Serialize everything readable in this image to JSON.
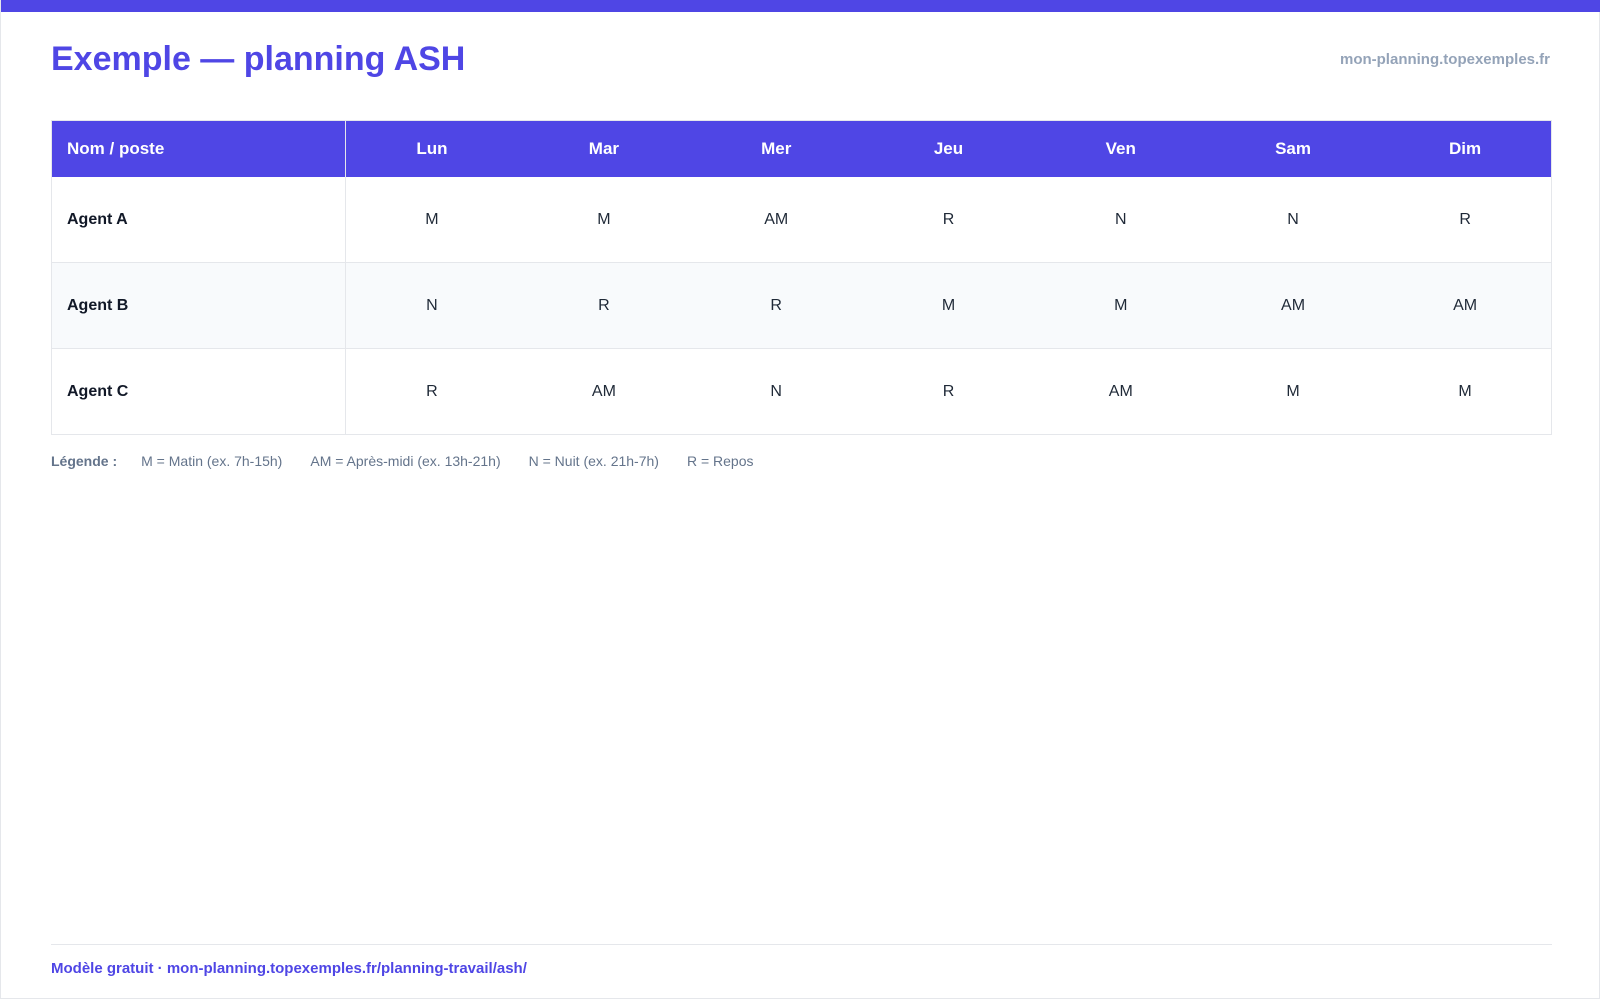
{
  "header": {
    "title": "Exemple — planning ASH",
    "site": "mon-planning.topexemples.fr"
  },
  "table": {
    "columns": [
      "Nom / poste",
      "Lun",
      "Mar",
      "Mer",
      "Jeu",
      "Ven",
      "Sam",
      "Dim"
    ],
    "rows": [
      {
        "name": "Agent A",
        "shifts": [
          "M",
          "M",
          "AM",
          "R",
          "N",
          "N",
          "R"
        ]
      },
      {
        "name": "Agent B",
        "shifts": [
          "N",
          "R",
          "R",
          "M",
          "M",
          "AM",
          "AM"
        ]
      },
      {
        "name": "Agent C",
        "shifts": [
          "R",
          "AM",
          "N",
          "R",
          "AM",
          "M",
          "M"
        ]
      }
    ]
  },
  "legend": {
    "label": "Légende :",
    "items": [
      "M = Matin (ex. 7h-15h)",
      "AM = Après-midi (ex. 13h-21h)",
      "N = Nuit (ex. 21h-7h)",
      "R = Repos"
    ]
  },
  "footer": {
    "text": "Modèle gratuit · mon-planning.topexemples.fr/planning-travail/ash/"
  },
  "colors": {
    "accent": "#4f46e5",
    "muted": "#94a3b8",
    "legend_text": "#64748b",
    "alt_row": "#f8fafc"
  }
}
